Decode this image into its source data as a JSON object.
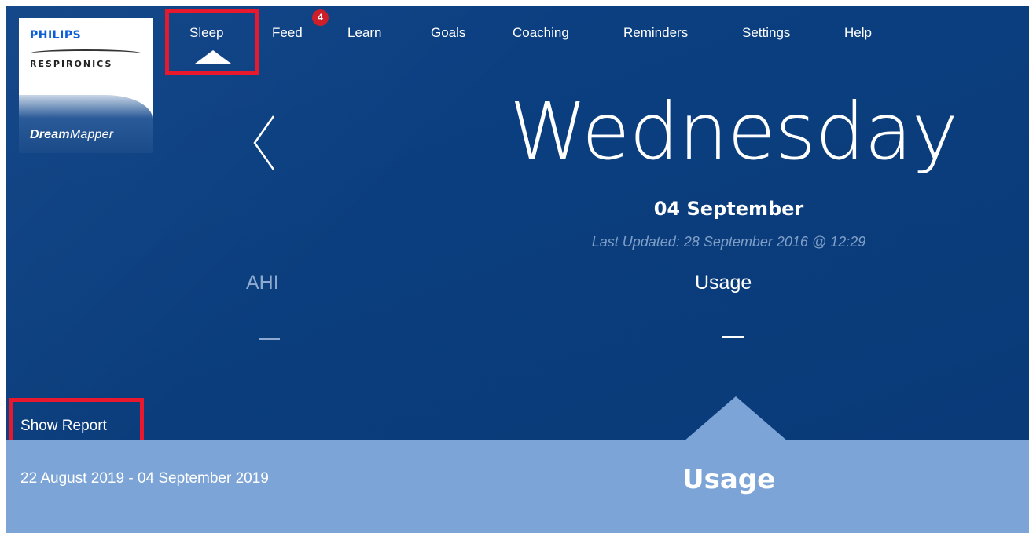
{
  "logo": {
    "brand": "PHILIPS",
    "subbrand": "RESPIRONICS",
    "product_prefix": "Dream",
    "product_suffix": "Mapper"
  },
  "nav": {
    "items": [
      {
        "label": "Sleep",
        "active": true
      },
      {
        "label": "Feed",
        "badge": "4"
      },
      {
        "label": "Learn"
      },
      {
        "label": "Goals"
      },
      {
        "label": "Coaching"
      },
      {
        "label": "Reminders"
      },
      {
        "label": "Settings"
      },
      {
        "label": "Help"
      }
    ]
  },
  "hero": {
    "day": "Wednesday",
    "date": "04 September",
    "last_updated": "Last Updated: 28 September 2016 @ 12:29",
    "metrics": [
      {
        "label": "AHI",
        "value": "—"
      },
      {
        "label": "Usage",
        "value": "—"
      }
    ],
    "show_report": "Show Report"
  },
  "panel": {
    "date_range": "22 August 2019 - 04 September 2019",
    "title": "Usage"
  },
  "colors": {
    "background": "#0b3f80",
    "panel": "#7ca4d6",
    "highlight": "#e8192c",
    "badge": "#cc1f2a",
    "muted_text": "#7f9fc7"
  }
}
